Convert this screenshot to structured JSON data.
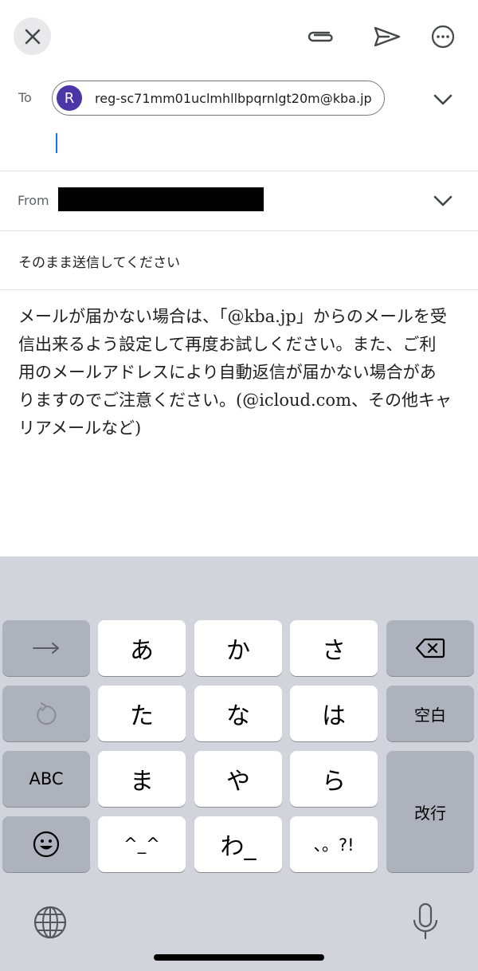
{
  "compose": {
    "to_label": "To",
    "recipient": {
      "avatar_letter": "R",
      "email": "reg-sc71mm01uclmhllbpqrnlgt20m@kba.jp"
    },
    "from_label": "From",
    "subject": "そのまま送信してください",
    "body_lines": [
      "メールが届かない場合は、「@kba.jp」からのメールを受",
      "信出来るよう設定して再度お試しください。また、ご利",
      "用のメールアドレスにより自動返信が届かない場合があ",
      "りますのでご注意ください。(@icloud.com、その他キャ",
      "リアメールなど)"
    ]
  },
  "toolbar": {
    "close_icon": "close-icon",
    "attach_icon": "paperclip-icon",
    "send_icon": "send-icon",
    "more_icon": "more-horizontal-icon"
  },
  "keyboard": {
    "keys": {
      "a": "あ",
      "ka": "か",
      "sa": "さ",
      "ta": "た",
      "na": "な",
      "ha": "は",
      "ma": "ま",
      "ya": "や",
      "ra": "ら",
      "kao": "^_^",
      "wa": "わ_",
      "punct": "、。?!",
      "abc": "ABC",
      "space": "空白",
      "enter": "改行"
    }
  },
  "colors": {
    "avatar": "#4a36a6",
    "cursor": "#1a73e8",
    "keyboard_bg": "#d2d4dc",
    "key_light": "#ffffff",
    "key_dark": "#aeb2bd"
  }
}
